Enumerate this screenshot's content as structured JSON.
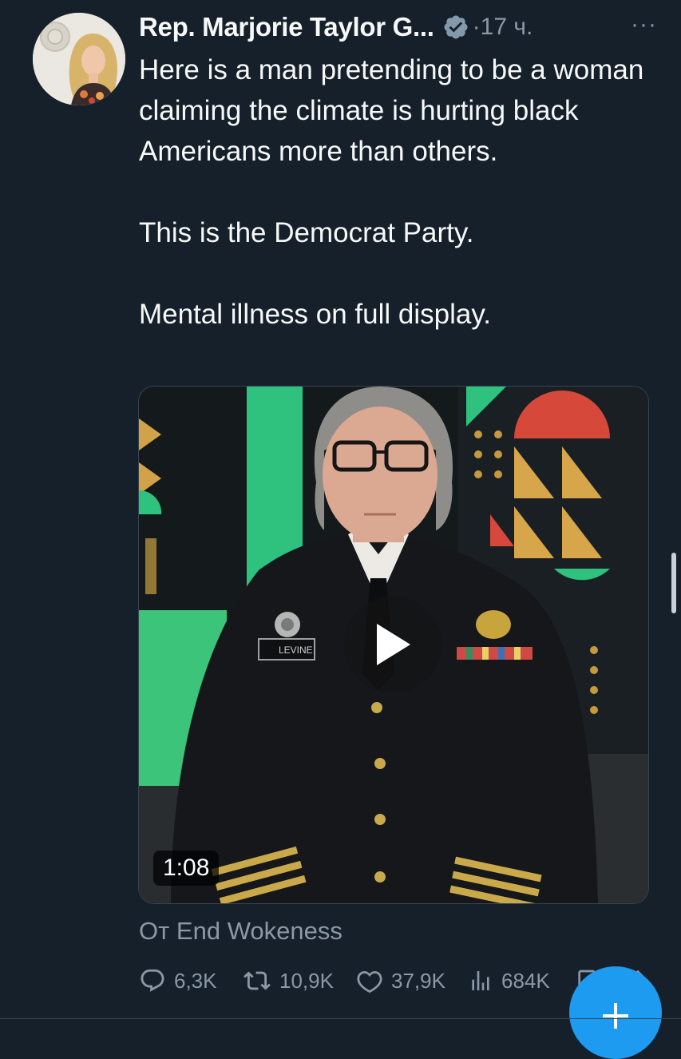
{
  "tweet": {
    "author_name": "Rep. Marjorie Taylor G...",
    "time_ago": "·17 ч.",
    "more_label": "···",
    "text_lines": [
      "Here is a man pretending to be a woman claiming the climate is hurting black Americans more than others.",
      "This is the Democrat Party.",
      "Mental illness on full display."
    ],
    "video": {
      "duration": "1:08",
      "name_tag": "LEVINE"
    },
    "source": "От End Wokeness"
  },
  "actions": {
    "replies": "6,3K",
    "retweets": "10,9K",
    "likes": "37,9K",
    "views": "684K"
  },
  "icons": {
    "verified": "verified-badge-icon",
    "reply": "reply-icon",
    "retweet": "retweet-icon",
    "like": "heart-icon",
    "views": "views-icon",
    "bookmark": "bookmark-icon",
    "share": "share-icon",
    "compose": "plus-icon"
  },
  "colors": {
    "background": "#15202b",
    "text": "#f7f9f9",
    "secondary": "#8b98a5",
    "accent": "#1d9bf0"
  }
}
